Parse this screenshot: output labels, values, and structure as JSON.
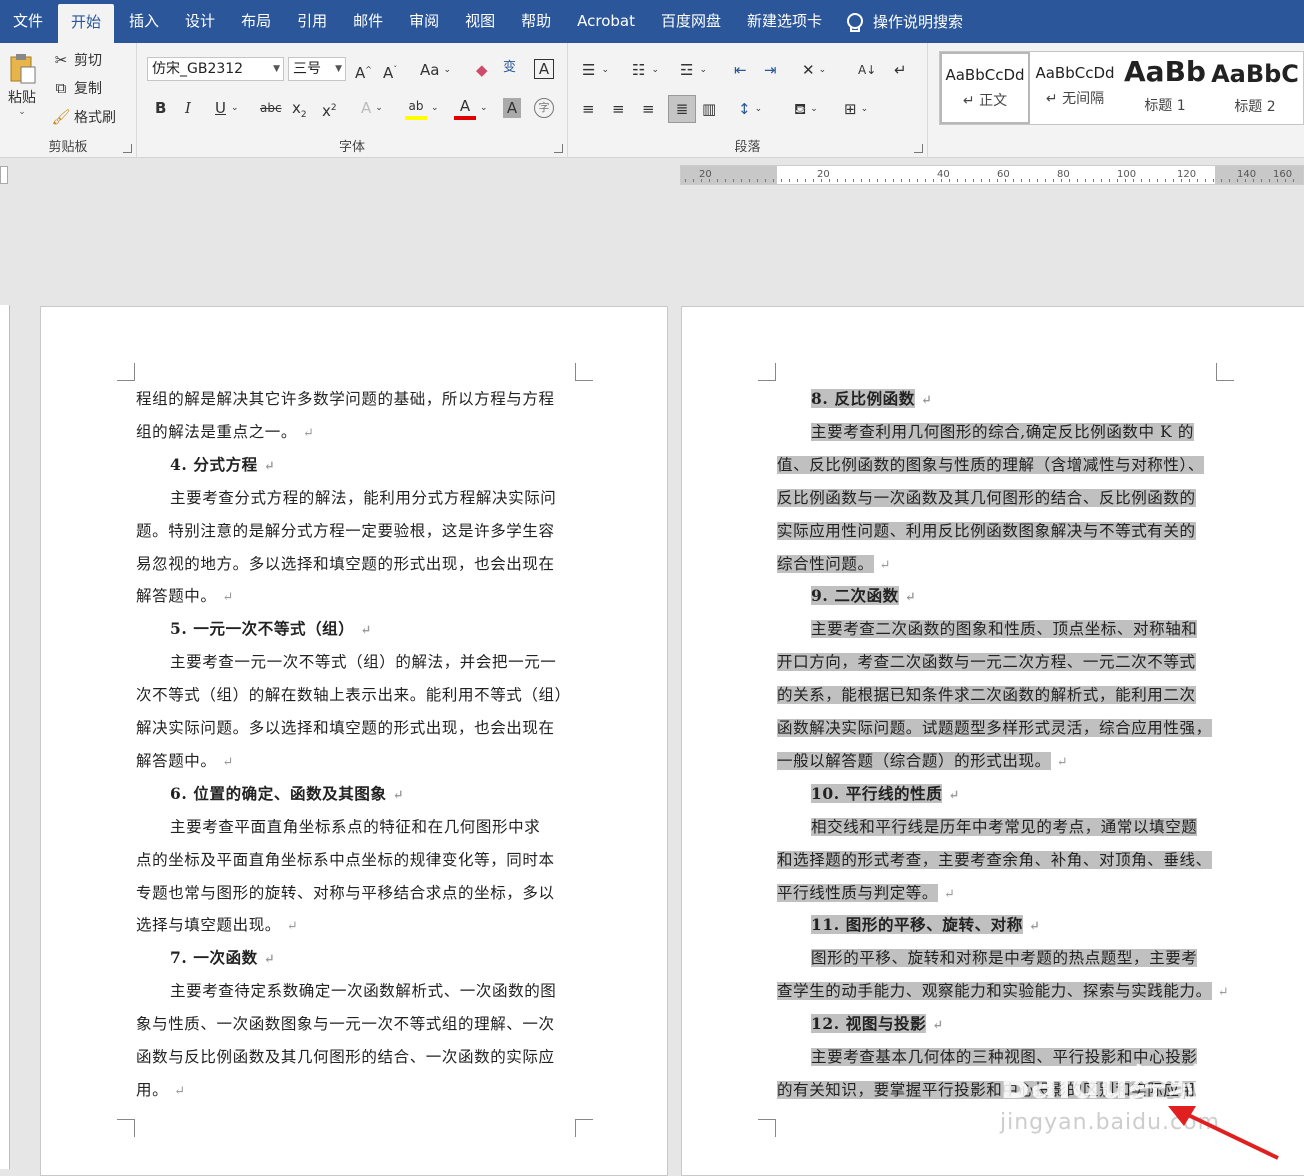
{
  "menubar": {
    "tabs": [
      "文件",
      "开始",
      "插入",
      "设计",
      "布局",
      "引用",
      "邮件",
      "审阅",
      "视图",
      "帮助",
      "Acrobat",
      "百度网盘",
      "新建选项卡"
    ],
    "active": "开始",
    "tell_me": "操作说明搜索",
    "bg_color": "#2b579a"
  },
  "clipboard": {
    "label": "剪贴板",
    "paste": "粘贴",
    "cut": "剪切",
    "copy": "复制",
    "format_painter": "格式刷"
  },
  "font": {
    "label": "字体",
    "font_name": "仿宋_GB2312",
    "font_size": "三号"
  },
  "paragraph": {
    "label": "段落"
  },
  "styles": [
    {
      "preview": "AaBbCcDd",
      "name": "↵ 正文"
    },
    {
      "preview": "AaBbCcDd",
      "name": "↵ 无间隔"
    },
    {
      "preview": "AaBb",
      "name": "标题 1"
    },
    {
      "preview": "AaBbC",
      "name": "标题 2"
    }
  ],
  "ruler": {
    "numbers": [
      "20",
      "",
      "20",
      "40",
      "60",
      "80",
      "100",
      "120",
      "140",
      "",
      "160"
    ]
  },
  "page_left": {
    "lines": [
      {
        "t": "程组的解是解决其它许多数学问题的基础，所以方程与方程",
        "h": false
      },
      {
        "t": "组的解法是重点之一。",
        "h": false,
        "end": true
      },
      {
        "t": "4. 分式方程",
        "h": true,
        "end": true
      },
      {
        "t": "主要考查分式方程的解法，能利用分式方程解决实际问",
        "h": false,
        "indent": true
      },
      {
        "t": "题。特别注意的是解分式方程一定要验根，这是许多学生容",
        "h": false
      },
      {
        "t": "易忽视的地方。多以选择和填空题的形式出现，也会出现在",
        "h": false
      },
      {
        "t": "解答题中。",
        "h": false,
        "end": true
      },
      {
        "t": "5. 一元一次不等式（组）",
        "h": true,
        "end": true
      },
      {
        "t": "主要考查一元一次不等式（组）的解法，并会把一元一",
        "h": false,
        "indent": true
      },
      {
        "t": "次不等式（组）的解在数轴上表示出来。能利用不等式（组）",
        "h": false
      },
      {
        "t": "解决实际问题。多以选择和填空题的形式出现，也会出现在",
        "h": false
      },
      {
        "t": "解答题中。",
        "h": false,
        "end": true
      },
      {
        "t": "6. 位置的确定、函数及其图象",
        "h": true,
        "end": true
      },
      {
        "t": "主要考查平面直角坐标系点的特征和在几何图形中求",
        "h": false,
        "indent": true
      },
      {
        "t": "点的坐标及平面直角坐标系中点坐标的规律变化等，同时本",
        "h": false
      },
      {
        "t": "专题也常与图形的旋转、对称与平移结合求点的坐标，多以",
        "h": false
      },
      {
        "t": "选择与填空题出现。",
        "h": false,
        "end": true
      },
      {
        "t": "7. 一次函数",
        "h": true,
        "end": true
      },
      {
        "t": "主要考查待定系数确定一次函数解析式、一次函数的图",
        "h": false,
        "indent": true
      },
      {
        "t": "象与性质、一次函数图象与一元一次不等式组的理解、一次",
        "h": false
      },
      {
        "t": "函数与反比例函数及其几何图形的结合、一次函数的实际应",
        "h": false
      },
      {
        "t": "用。",
        "h": false,
        "end": true
      }
    ]
  },
  "page_right": {
    "lines": [
      {
        "t": "8. 反比例函数",
        "h": true,
        "end": true
      },
      {
        "t": "主要考查利用几何图形的综合,确定反比例函数中 K 的",
        "h": false,
        "indent": true
      },
      {
        "t": "值、反比例函数的图象与性质的理解（含增减性与对称性）、",
        "h": false
      },
      {
        "t": "反比例函数与一次函数及其几何图形的结合、反比例函数的",
        "h": false
      },
      {
        "t": "实际应用性问题、利用反比例函数图象解决与不等式有关的",
        "h": false
      },
      {
        "t": "综合性问题。",
        "h": false,
        "end": true
      },
      {
        "t": "9. 二次函数",
        "h": true,
        "end": true
      },
      {
        "t": "主要考查二次函数的图象和性质、顶点坐标、对称轴和",
        "h": false,
        "indent": true
      },
      {
        "t": "开口方向，考查二次函数与一元二次方程、一元二次不等式",
        "h": false
      },
      {
        "t": "的关系，能根据已知条件求二次函数的解析式，能利用二次",
        "h": false
      },
      {
        "t": "函数解决实际问题。试题题型多样形式灵活，综合应用性强，",
        "h": false
      },
      {
        "t": "一般以解答题（综合题）的形式出现。",
        "h": false,
        "end": true
      },
      {
        "t": "10. 平行线的性质",
        "h": true,
        "end": true
      },
      {
        "t": "相交线和平行线是历年中考常见的考点，通常以填空题",
        "h": false,
        "indent": true
      },
      {
        "t": "和选择题的形式考查，主要考查余角、补角、对顶角、垂线、",
        "h": false
      },
      {
        "t": "平行线性质与判定等。",
        "h": false,
        "end": true
      },
      {
        "t": "11. 图形的平移、旋转、对称",
        "h": true,
        "end": true
      },
      {
        "t": "图形的平移、旋转和对称是中考题的热点题型，主要考",
        "h": false,
        "indent": true
      },
      {
        "t": "查学生的动手能力、观察能力和实验能力、探索与实践能力。",
        "h": false,
        "end": true
      },
      {
        "t": "12. 视图与投影",
        "h": true,
        "end": true
      },
      {
        "t": "主要考查基本几何体的三种视图、平行投影和中心投影",
        "h": false,
        "indent": true
      },
      {
        "t": "的有关知识，要掌握平行投影和中心投影的区别和实际应用",
        "h": false
      }
    ]
  },
  "watermark": {
    "line1": "Baidu经验",
    "line2": "jingyan.baidu.com"
  }
}
